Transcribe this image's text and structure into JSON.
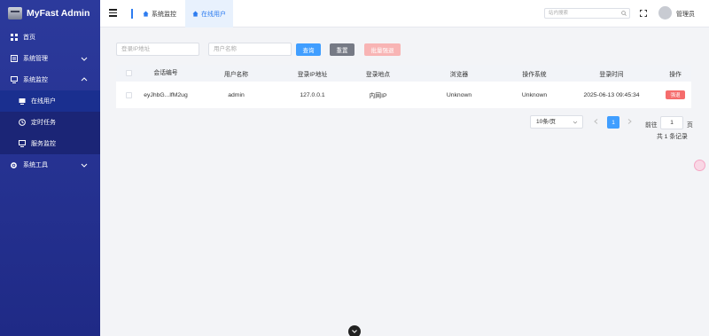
{
  "app": {
    "title": "MyFast Admin"
  },
  "sidebar": {
    "items": [
      {
        "label": "首页"
      },
      {
        "label": "系统管理"
      },
      {
        "label": "系统监控"
      },
      {
        "label": "系统工具"
      }
    ],
    "submenu": [
      {
        "label": "在线用户"
      },
      {
        "label": "定时任务"
      },
      {
        "label": "服务监控"
      }
    ]
  },
  "header": {
    "tabs": [
      {
        "label": "系统监控"
      },
      {
        "label": "在线用户"
      }
    ],
    "search_placeholder": "站内搜索",
    "username": "管理员"
  },
  "filters": {
    "ip_placeholder": "登录IP地址",
    "user_placeholder": "用户名称",
    "query_label": "查询",
    "reset_label": "重置",
    "batch_label": "批量强退"
  },
  "table": {
    "headers": [
      "会话编号",
      "用户名称",
      "登录IP地址",
      "登录地点",
      "浏览器",
      "操作系统",
      "登录时间",
      "操作"
    ],
    "rows": [
      {
        "session_id": "eyJhbG...lfM2ug",
        "username": "admin",
        "ip": "127.0.0.1",
        "location": "内网IP",
        "browser": "Unknown",
        "os": "Unknown",
        "login_time": "2025-06-13 09:45:34",
        "action": "强退"
      }
    ]
  },
  "pagination": {
    "page_size": "10条/页",
    "current_page": "1",
    "goto_label": "前往",
    "goto_value": "1",
    "goto_unit": "页",
    "total": "共 1 条记录"
  },
  "colors": {
    "sidebar": "#2c3a9c",
    "primary": "#409eff",
    "danger": "#f56c6c"
  }
}
